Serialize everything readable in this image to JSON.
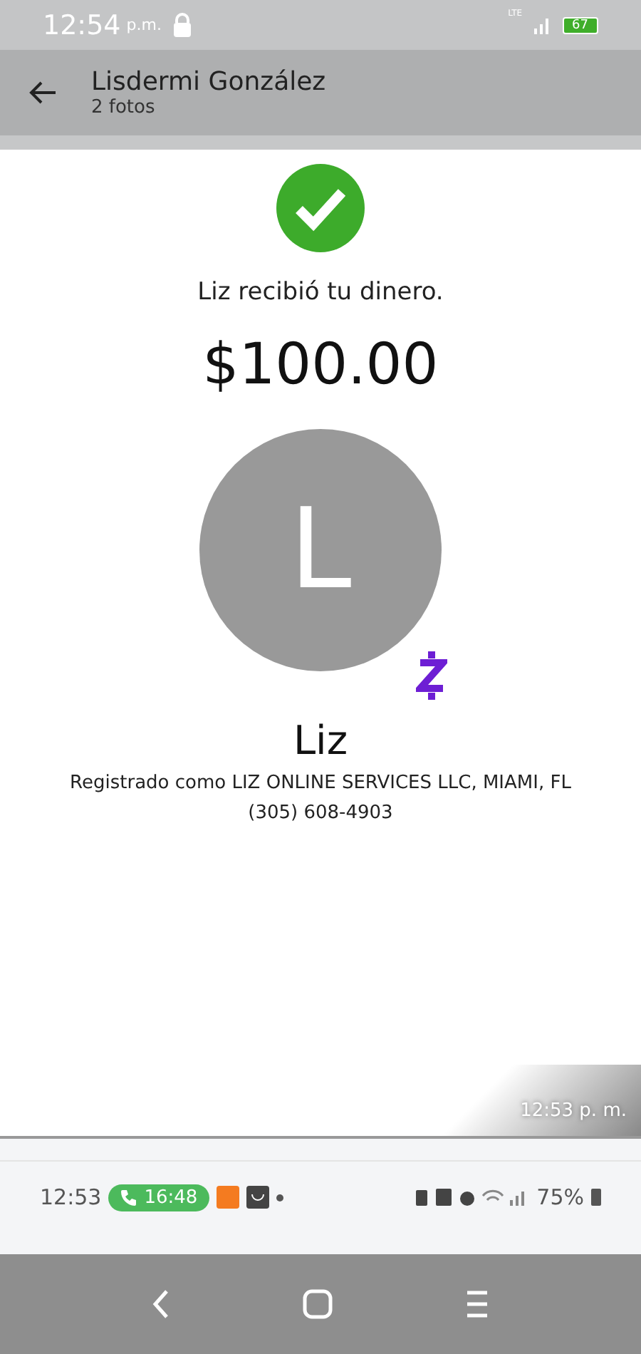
{
  "status_bar": {
    "time": "12:54",
    "ampm": "p.m.",
    "network": "LTE",
    "battery": "67"
  },
  "header": {
    "title": "Lisdermi González",
    "subtitle": "2 fotos"
  },
  "receipt": {
    "message": "Liz recibió tu dinero.",
    "amount": "$100.00",
    "avatar_letter": "L",
    "name": "Liz",
    "registered": "Registrado como LIZ ONLINE SERVICES LLC, MIAMI, FL",
    "phone": "(305) 608-4903"
  },
  "timestamp": "12:53 p. m.",
  "inner_status_bar": {
    "time": "12:53",
    "call_time": "16:48",
    "battery": "75%"
  }
}
